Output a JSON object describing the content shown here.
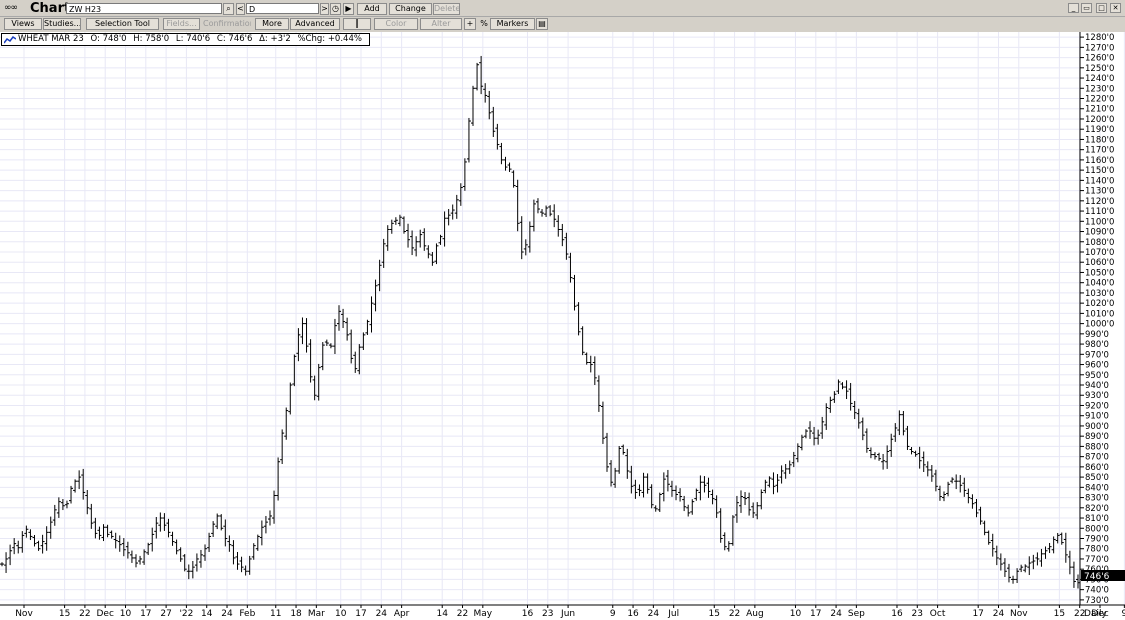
{
  "window": {
    "title": "Chart",
    "symbol": "ZW H23",
    "interval": "D"
  },
  "titlebar_buttons": {
    "search": "⌕",
    "prev": "<",
    "next": ">",
    "history": "◷",
    "play": "▶",
    "add": "Add",
    "change": "Change",
    "delete": "Delete",
    "minimize": "_",
    "restore": "▭",
    "maximize": "□",
    "close": "✕"
  },
  "toolbar": {
    "views": "Views",
    "studies": "Studies...",
    "selection_tool": "Selection Tool",
    "fields": "Fields...",
    "confirmation": "Confirmation",
    "more": "More",
    "advanced": "Advanced",
    "bar_style": "┃",
    "color": "Color",
    "alter": "Alter",
    "crosshair": "+",
    "percent": "%",
    "markers": "Markers",
    "print": "▤"
  },
  "legend": {
    "name": "WHEAT MAR 23",
    "open": "O: 748'0",
    "high": "H: 758'0",
    "low": "L: 740'6",
    "close": "C: 746'6",
    "delta": "Δ: +3'2",
    "pct_change": "%Chg: +0.44%"
  },
  "colors": {
    "background": "#ffffff",
    "grid": "#e8e8f6",
    "bars": "#000000",
    "price_tag_bg": "#000000",
    "price_tag_text": "#ffffff",
    "window_chrome": "#d4d0c8"
  },
  "chart_data": {
    "type": "ohlc",
    "instrument": "WHEAT MAR 23",
    "interval_label": "Daily",
    "ylim": [
      725,
      1285
    ],
    "last_price_label": "746'6",
    "last_price": 746.75,
    "y_ticks": [
      "730'0",
      "740'0",
      "750'0",
      "760'0",
      "770'0",
      "780'0",
      "790'0",
      "800'0",
      "810'0",
      "820'0",
      "830'0",
      "840'0",
      "850'0",
      "860'0",
      "870'0",
      "880'0",
      "890'0",
      "900'0",
      "910'0",
      "920'0",
      "930'0",
      "940'0",
      "950'0",
      "960'0",
      "970'0",
      "980'0",
      "990'0",
      "1000'0",
      "1010'0",
      "1020'0",
      "1030'0",
      "1040'0",
      "1050'0",
      "1060'0",
      "1070'0",
      "1080'0",
      "1090'0",
      "1100'0",
      "1110'0",
      "1120'0",
      "1130'0",
      "1140'0",
      "1150'0",
      "1160'0",
      "1170'0",
      "1180'0",
      "1190'0",
      "1200'0",
      "1210'0",
      "1220'0",
      "1230'0",
      "1240'0",
      "1250'0",
      "1260'0",
      "1270'0",
      "1280'0"
    ],
    "y_tick_values": [
      730,
      740,
      750,
      760,
      770,
      780,
      790,
      800,
      810,
      820,
      830,
      840,
      850,
      860,
      870,
      880,
      890,
      900,
      910,
      920,
      930,
      940,
      950,
      960,
      970,
      980,
      990,
      1000,
      1010,
      1020,
      1030,
      1040,
      1050,
      1060,
      1070,
      1080,
      1090,
      1100,
      1110,
      1120,
      1130,
      1140,
      1150,
      1160,
      1170,
      1180,
      1190,
      1200,
      1210,
      1220,
      1230,
      1240,
      1250,
      1260,
      1270,
      1280
    ],
    "x_ticks": [
      "Nov",
      "15",
      "22",
      "Dec",
      "10",
      "17",
      "27",
      "'22",
      "14",
      "24",
      "Feb",
      "11",
      "18",
      "Mar",
      "10",
      "17",
      "24",
      "Apr",
      "14",
      "22",
      "May",
      "16",
      "23",
      "Jun",
      "9",
      "16",
      "24",
      "Jul",
      "15",
      "22",
      "Aug",
      "10",
      "17",
      "24",
      "Sep",
      "16",
      "23",
      "Oct",
      "17",
      "24",
      "Nov",
      "15",
      "22",
      "Dec",
      "9",
      "16",
      "23",
      "'23"
    ],
    "x_tick_bar_index": [
      0,
      10,
      15,
      20,
      25,
      30,
      35,
      40,
      45,
      50,
      55,
      62,
      67,
      72,
      78,
      83,
      88,
      93,
      103,
      108,
      113,
      124,
      129,
      134,
      145,
      150,
      155,
      160,
      170,
      175,
      180,
      190,
      195,
      200,
      205,
      215,
      220,
      225,
      235,
      240,
      245,
      255,
      260,
      265,
      271,
      276,
      281,
      286
    ],
    "closes": [
      765,
      770,
      778,
      785,
      781,
      793,
      799,
      792,
      785,
      780,
      787,
      796,
      806,
      818,
      826,
      822,
      824,
      839,
      846,
      850,
      835,
      820,
      805,
      795,
      793,
      801,
      794,
      792,
      788,
      784,
      779,
      776,
      771,
      766,
      770,
      777,
      784,
      794,
      805,
      810,
      803,
      796,
      787,
      778,
      770,
      760,
      758,
      762,
      770,
      774,
      780,
      792,
      804,
      812,
      800,
      790,
      784,
      771,
      765,
      762,
      758,
      770,
      783,
      792,
      801,
      806,
      812,
      832,
      865,
      893,
      915,
      940,
      968,
      989,
      1000,
      978,
      948,
      930,
      957,
      979,
      981,
      978,
      998,
      1012,
      1002,
      989,
      966,
      956,
      977,
      989,
      1002,
      1020,
      1037,
      1057,
      1078,
      1092,
      1098,
      1101,
      1104,
      1090,
      1082,
      1074,
      1080,
      1087,
      1076,
      1068,
      1060,
      1076,
      1085,
      1103,
      1106,
      1111,
      1121,
      1133,
      1158,
      1198,
      1230,
      1253,
      1232,
      1223,
      1206,
      1188,
      1175,
      1160,
      1153,
      1151,
      1135,
      1098,
      1070,
      1077,
      1095,
      1117,
      1112,
      1108,
      1113,
      1107,
      1102,
      1092,
      1082,
      1068,
      1045,
      1017,
      992,
      972,
      962,
      960,
      947,
      920,
      888,
      860,
      845,
      856,
      878,
      874,
      856,
      841,
      835,
      837,
      850,
      838,
      823,
      819,
      833,
      848,
      843,
      837,
      833,
      831,
      821,
      815,
      826,
      837,
      845,
      842,
      836,
      829,
      815,
      790,
      782,
      785,
      811,
      825,
      831,
      829,
      818,
      815,
      822,
      835,
      845,
      849,
      841,
      847,
      856,
      858,
      862,
      871,
      880,
      889,
      895,
      895,
      888,
      891,
      904,
      918,
      925,
      931,
      943,
      938,
      934,
      922,
      913,
      903,
      891,
      878,
      872,
      870,
      868,
      866,
      875,
      887,
      898,
      911,
      895,
      880,
      875,
      872,
      866,
      862,
      857,
      851,
      841,
      831,
      833,
      843,
      848,
      846,
      842,
      837,
      830,
      824,
      815,
      807,
      796,
      786,
      780,
      771,
      765,
      758,
      752,
      750,
      758,
      762,
      763,
      766,
      768,
      770,
      775,
      778,
      782,
      789,
      793,
      786,
      774,
      762,
      748,
      746.75
    ],
    "ohlc_bars": "one bar per closes[] entry; open/high/low are the close ±2–9 cents"
  }
}
